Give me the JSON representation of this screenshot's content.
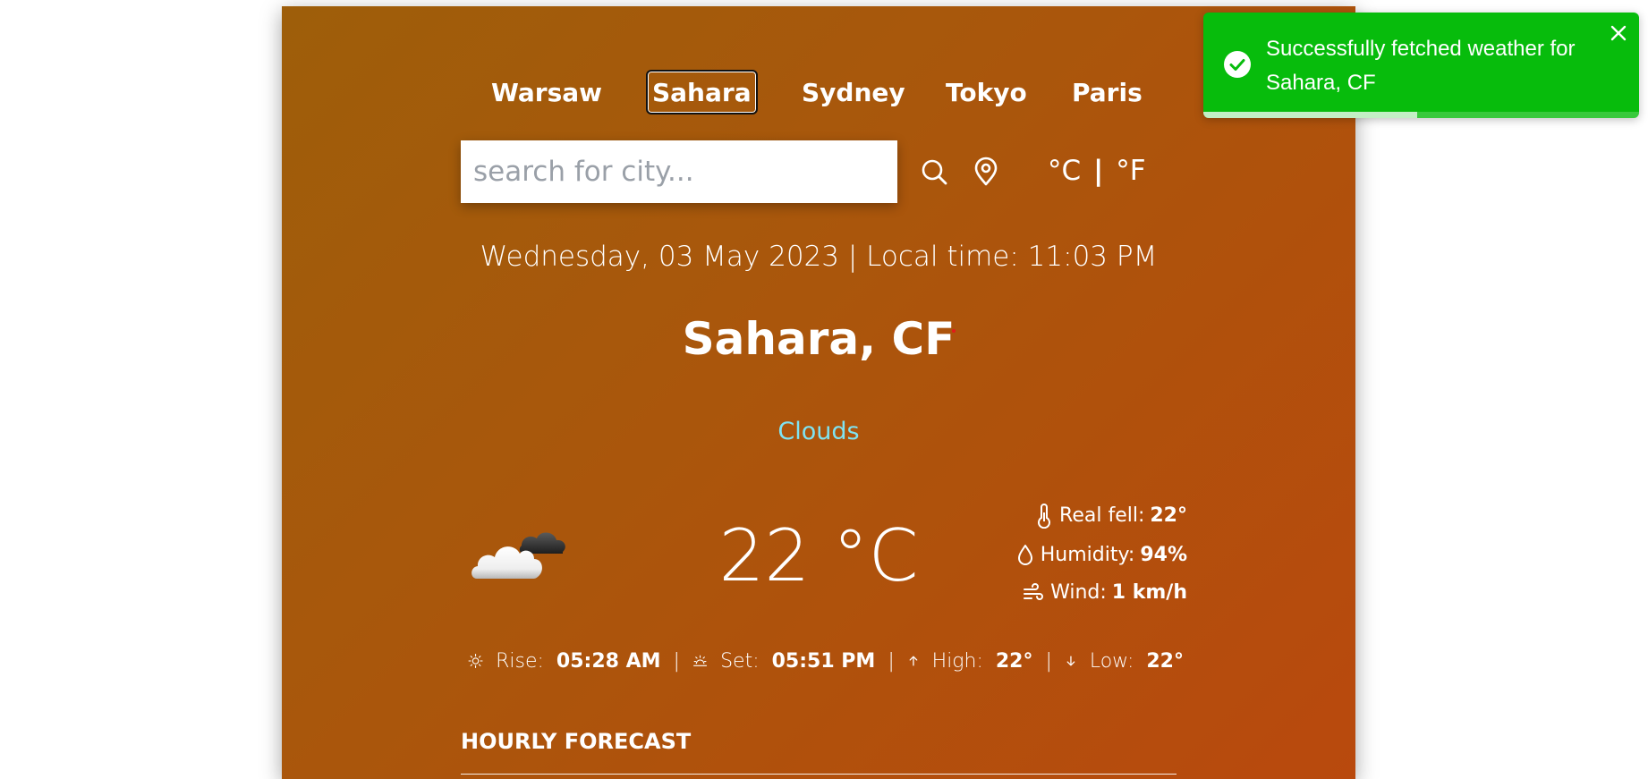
{
  "nav": {
    "cities": [
      "Warsaw",
      "Sahara",
      "Sydney",
      "Tokyo",
      "Paris"
    ],
    "active_city": "Sahara"
  },
  "search": {
    "placeholder": "search for city...",
    "value": ""
  },
  "units": {
    "celsius": "°C",
    "separator": "|",
    "fahrenheit": "°F"
  },
  "datetime": "Wednesday, 03 May 2023 | Local time: 11:03 PM",
  "location": "Sahara, CF",
  "condition": "Clouds",
  "condition_color": "#7fe3f2",
  "weather_icon": "cloud-icon",
  "temperature": "22 °C",
  "details": {
    "real_feel_label": "Real fell:",
    "real_feel_value": "22°",
    "humidity_label": "Humidity:",
    "humidity_value": "94%",
    "wind_label": "Wind:",
    "wind_value": "1 km/h"
  },
  "sun": {
    "rise_label": "Rise:",
    "rise_value": "05:28 AM",
    "set_label": "Set:",
    "set_value": "05:51 PM",
    "high_label": "High:",
    "high_value": "22°",
    "low_label": "Low:",
    "low_value": "22°",
    "separator": "|"
  },
  "hourly_forecast_title": "HOURLY FORECAST",
  "toast": {
    "message": "Successfully fetched weather for Sahara, CF",
    "color": "#07bc0c",
    "progress": 0.49
  },
  "colors": {
    "gradient_start": "#9e5e0a",
    "gradient_end": "#b9490d"
  }
}
